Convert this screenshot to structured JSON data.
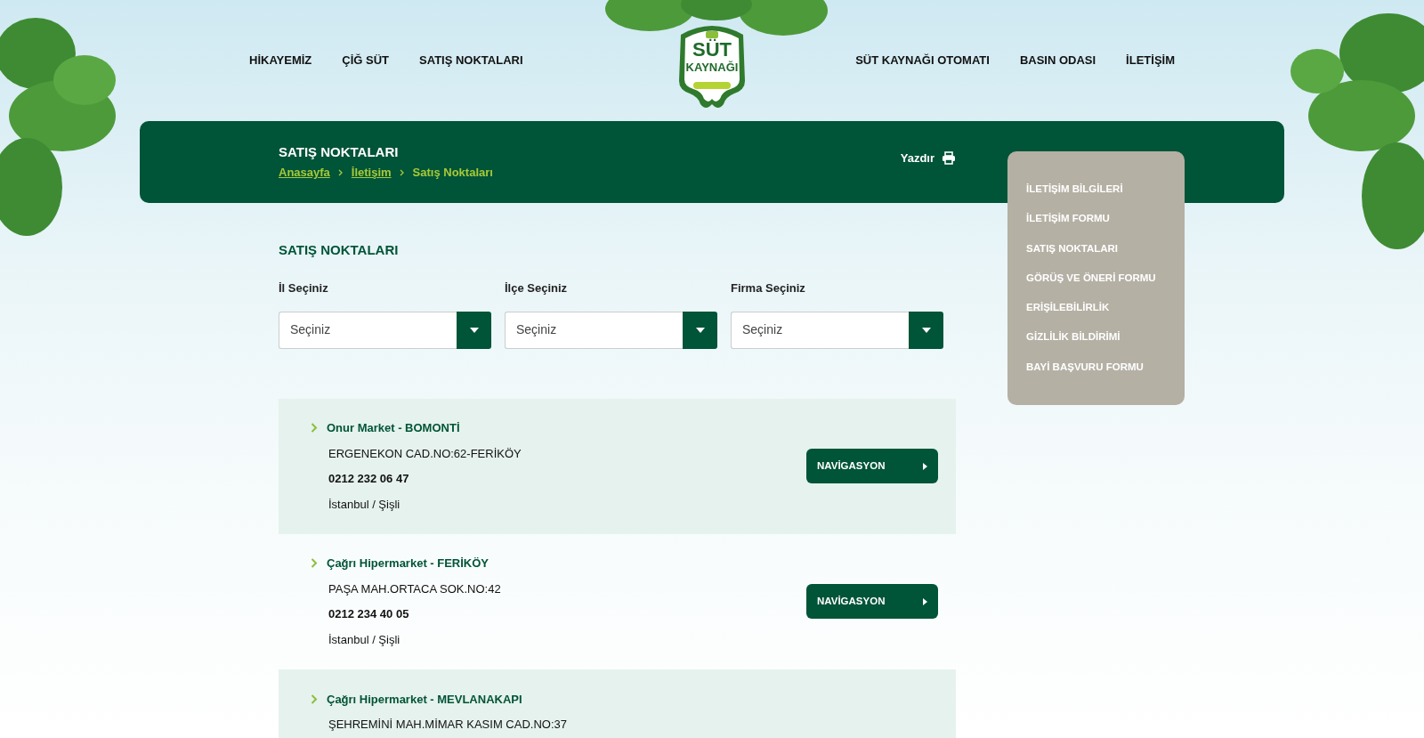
{
  "nav_left": [
    "HİKAYEMİZ",
    "ÇİĞ SÜT",
    "SATIŞ NOKTALARI"
  ],
  "logo": {
    "line1": "SÜT",
    "line2": "KAYNAĞI"
  },
  "nav_right": [
    "SÜT KAYNAĞI OTOMATI",
    "BASIN ODASI",
    "İLETİŞİM"
  ],
  "page_header": {
    "title": "SATIŞ NOKTALARI",
    "breadcrumbs": [
      {
        "label": "Anasayfa",
        "link": true
      },
      {
        "label": "İletişim",
        "link": true
      },
      {
        "label": "Satış Noktaları",
        "link": false
      }
    ],
    "print": "Yazdır"
  },
  "sidebar": {
    "items": [
      "İLETİŞİM BİLGİLERİ",
      "İLETİŞİM FORMU",
      "SATIŞ NOKTALARI",
      "GÖRÜŞ VE ÖNERİ FORMU",
      "ERİŞİLEBİLİRLİK",
      "GİZLİLİK BİLDİRİMİ",
      "BAYİ BAŞVURU FORMU"
    ]
  },
  "section_title": "SATIŞ NOKTALARI",
  "filters": [
    {
      "label": "İl Seçiniz",
      "placeholder": "Seçiniz"
    },
    {
      "label": "İlçe Seçiniz",
      "placeholder": "Seçiniz"
    },
    {
      "label": "Firma Seçiniz",
      "placeholder": "Seçiniz"
    }
  ],
  "stores": [
    {
      "name": "Onur Market - BOMONTİ",
      "address": "ERGENEKON CAD.NO:62-FERİKÖY",
      "phone": "0212 232 06 47",
      "city": "İstanbul / Şişli",
      "button": "NAVİGASYON"
    },
    {
      "name": "Çağrı Hipermarket - FERİKÖY",
      "address": "PAŞA MAH.ORTACA SOK.NO:42",
      "phone": "0212 234 40 05",
      "city": "İstanbul / Şişli",
      "button": "NAVİGASYON"
    },
    {
      "name": "Çağrı Hipermarket - MEVLANAKAPI",
      "address": "ŞEHREMİNİ MAH.MİMAR KASIM CAD.NO:37"
    }
  ]
}
